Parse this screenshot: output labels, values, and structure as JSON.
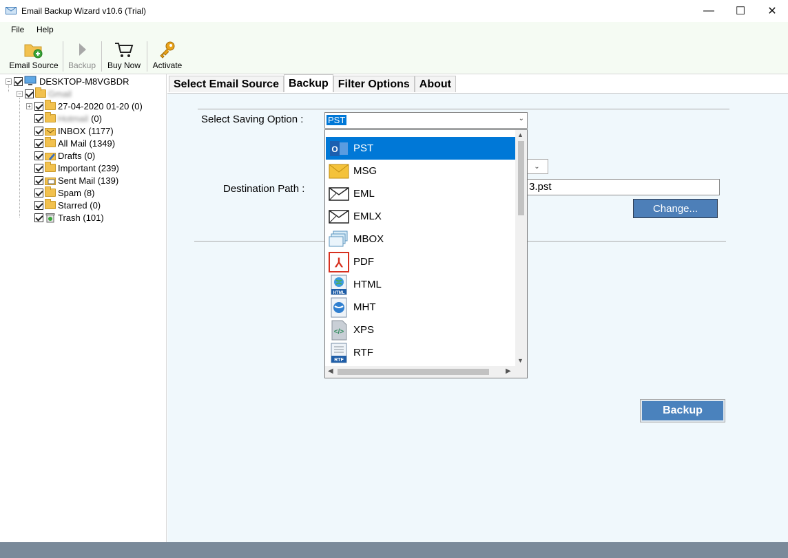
{
  "window": {
    "title": "Email Backup Wizard v10.6 (Trial)",
    "minimize": "—",
    "maximize": "☐",
    "close": "✕"
  },
  "menu": {
    "file": "File",
    "help": "Help"
  },
  "toolbar": {
    "email_source": "Email Source",
    "backup": "Backup",
    "buy_now": "Buy Now",
    "activate": "Activate"
  },
  "tree": {
    "root": "DESKTOP-M8VGBDR",
    "account": "Gmail",
    "items": [
      {
        "label": "27-04-2020 01-20 (0)"
      },
      {
        "label": "(0)",
        "blurred_prefix": "Hotmail"
      },
      {
        "label": "INBOX (1177)"
      },
      {
        "label": "All Mail (1349)"
      },
      {
        "label": "Drafts (0)"
      },
      {
        "label": "Important (239)"
      },
      {
        "label": "Sent Mail (139)"
      },
      {
        "label": "Spam (8)"
      },
      {
        "label": "Starred (0)"
      },
      {
        "label": "Trash (101)"
      }
    ]
  },
  "tabs": [
    {
      "label": "Select Email Source"
    },
    {
      "label": "Backup"
    },
    {
      "label": "Filter Options"
    },
    {
      "label": "About"
    }
  ],
  "backup": {
    "saving_option_label": "Select Saving Option :",
    "saving_option_value": "PST",
    "destination_label": "Destination Path :",
    "destination_value": "3.pst",
    "change_button": "Change...",
    "backup_button": "Backup"
  },
  "dropdown": {
    "items": [
      {
        "label": "PST",
        "icon": "outlook-icon",
        "selected": true
      },
      {
        "label": "MSG",
        "icon": "envelope-icon"
      },
      {
        "label": "EML",
        "icon": "mail-icon"
      },
      {
        "label": "EMLX",
        "icon": "mail-icon"
      },
      {
        "label": "MBOX",
        "icon": "mbox-icon"
      },
      {
        "label": "PDF",
        "icon": "pdf-icon"
      },
      {
        "label": "HTML",
        "icon": "html-icon"
      },
      {
        "label": "MHT",
        "icon": "mht-icon"
      },
      {
        "label": "XPS",
        "icon": "xps-icon"
      },
      {
        "label": "RTF",
        "icon": "rtf-icon"
      }
    ]
  },
  "icon_text": {
    "pst_letter": "O",
    "html_tag": "HTML",
    "rtf_tag": "RTF",
    "xps_glyph": "</>",
    "pdf_glyph": "⅄"
  },
  "colors": {
    "selection": "#0078d7",
    "button_blue": "#4a82bd",
    "panel_bg": "#f0f8fc",
    "toolbar_bg": "#f5fbf3",
    "statusbar": "#7a8a9a"
  }
}
